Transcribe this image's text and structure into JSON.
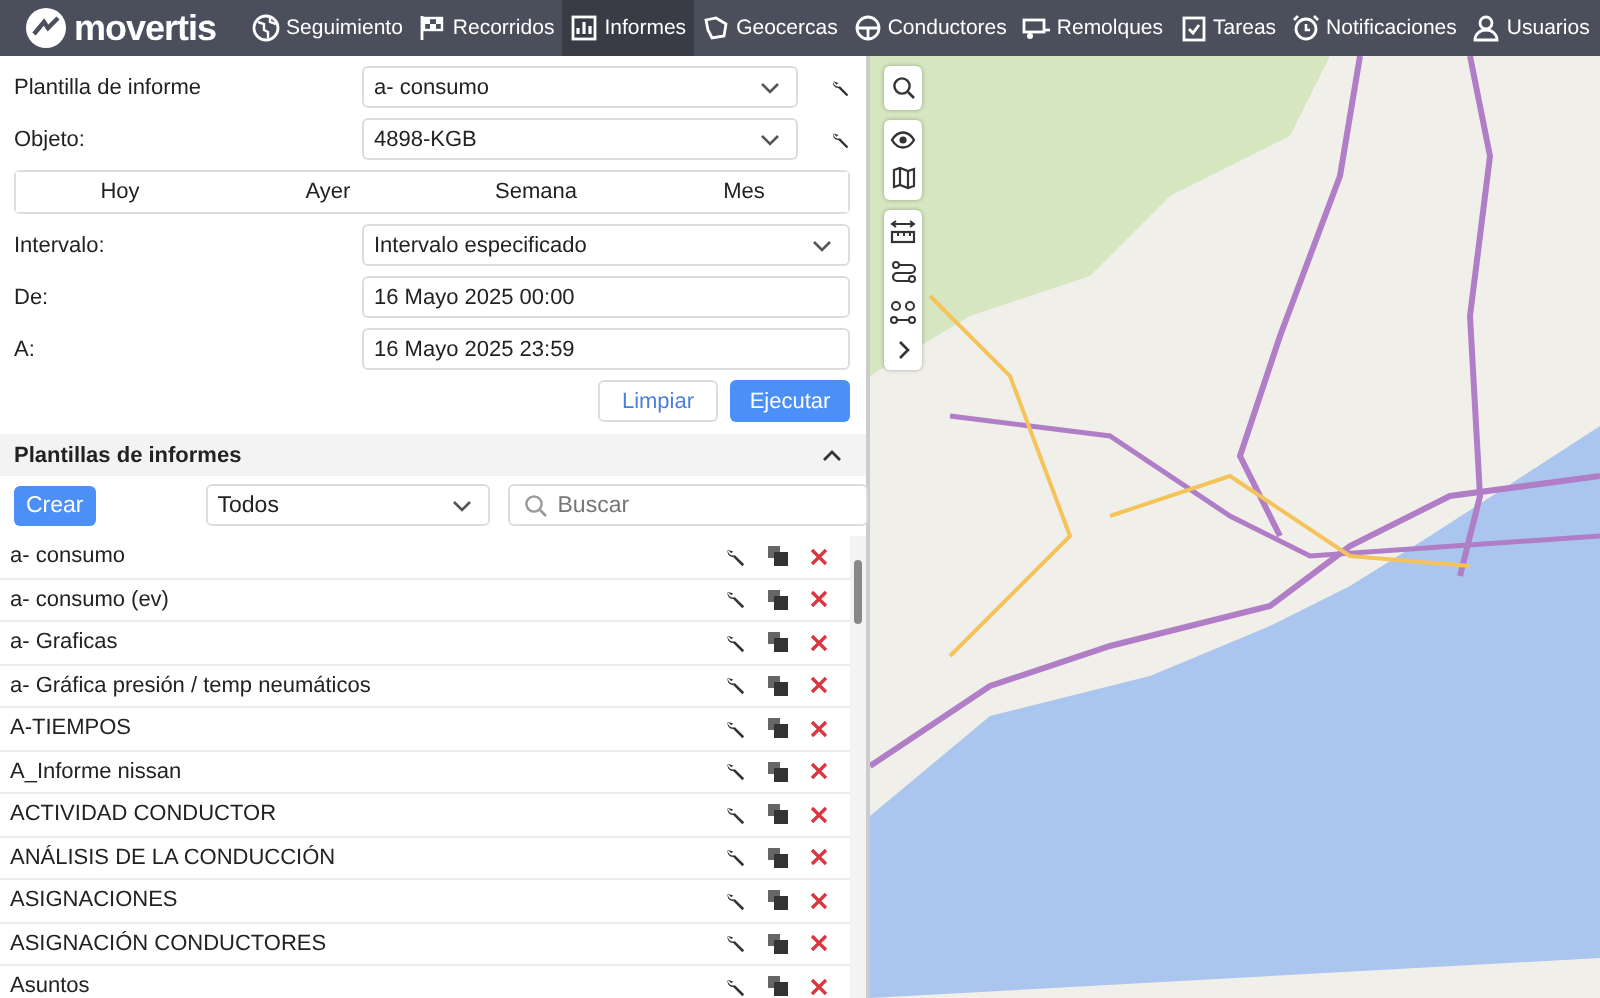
{
  "nav": {
    "logo": "movertis",
    "items": [
      {
        "label": "Seguimiento",
        "selected": false
      },
      {
        "label": "Recorridos",
        "selected": false
      },
      {
        "label": "Informes",
        "selected": true
      },
      {
        "label": "Geocercas",
        "selected": false
      },
      {
        "label": "Conductores",
        "selected": false
      },
      {
        "label": "Remolques",
        "selected": false
      },
      {
        "label": "Tareas",
        "selected": false
      },
      {
        "label": "Notificaciones",
        "selected": false
      },
      {
        "label": "Usuarios",
        "selected": false
      }
    ]
  },
  "report_form": {
    "template": {
      "label": "Plantilla de informe",
      "value": "a- consumo"
    },
    "object": {
      "label": "Objeto:",
      "value": "4898-KGB"
    },
    "periods": [
      "Hoy",
      "Ayer",
      "Semana",
      "Mes"
    ],
    "interval": {
      "label": "Intervalo:",
      "value": "Intervalo especificado"
    },
    "from": {
      "label": "De:",
      "value": "16 Mayo 2025 00:00"
    },
    "to": {
      "label": "A:",
      "value": "16 Mayo 2025 23:59"
    },
    "clear_button": "Limpiar",
    "run_button": "Ejecutar"
  },
  "templates": {
    "title": "Plantillas de informes",
    "expanded": true,
    "create_button": "Crear",
    "filter": "Todos",
    "search_placeholder": "Buscar",
    "items": [
      "a- consumo",
      "a- consumo (ev)",
      "a- Graficas",
      "a- Gráfica presión / temp neumáticos",
      "A-TIEMPOS",
      "A_Informe nissan",
      "ACTIVIDAD CONDUCTOR",
      "ANÁLISIS DE LA CONDUCCIÓN",
      "ASIGNACIONES",
      "ASIGNACIÓN CONDUCTORES",
      "Asuntos"
    ]
  }
}
